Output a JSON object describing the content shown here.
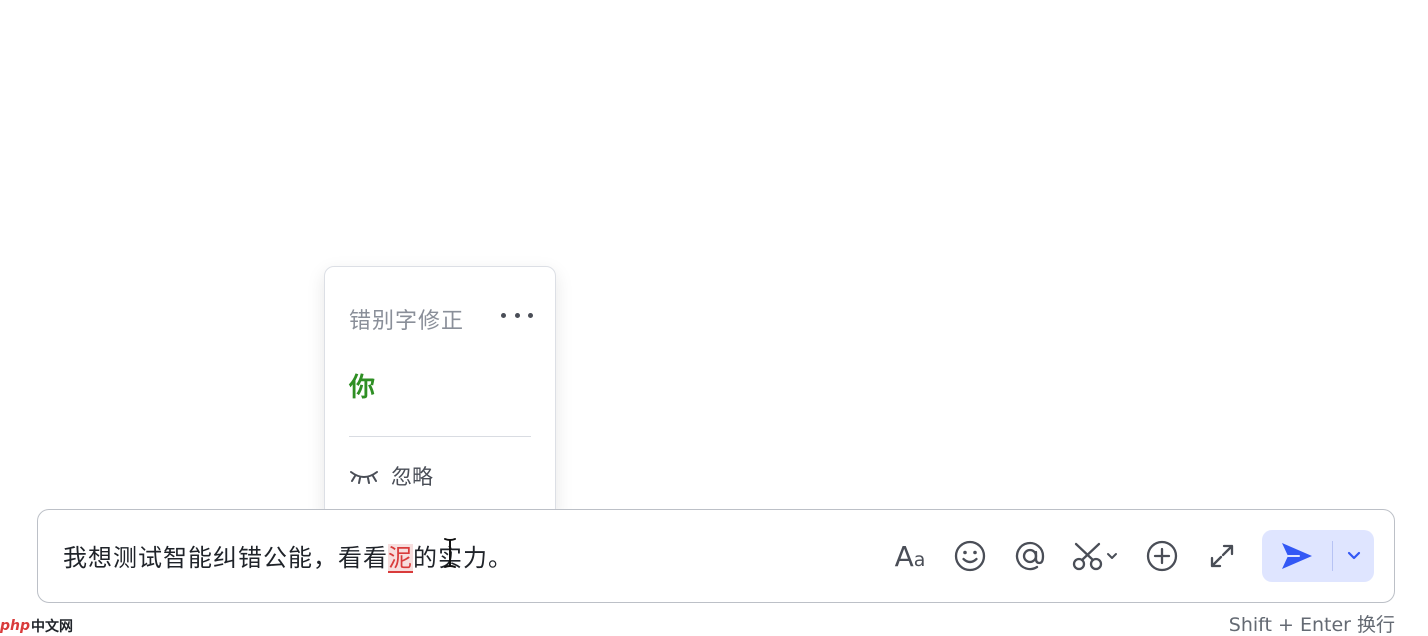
{
  "popup": {
    "title": "错别字修正",
    "suggestion": "你",
    "ignore_label": "忽略"
  },
  "composer": {
    "text_before": "我想测试智能纠错公能，看看",
    "typo": "泥",
    "text_after": "的实力。"
  },
  "toolbar": {
    "font_label": "A",
    "font_sub": "a"
  },
  "hint": "Shift + Enter 换行",
  "watermark": {
    "php": "php",
    "cn": "中文网"
  },
  "colors": {
    "suggestion": "#2f8f24",
    "typo": "#d93b3b",
    "send_bg": "#dfe5ff",
    "send_icon": "#3358f5"
  }
}
